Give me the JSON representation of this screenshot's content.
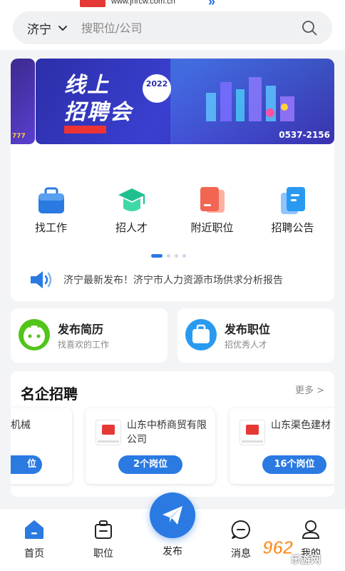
{
  "top_strip": {
    "url": "www.jnrcw.com.cn"
  },
  "search": {
    "city": "济宁",
    "placeholder": "搜职位/公司"
  },
  "banner": {
    "title_line1": "线上",
    "title_line2": "招聘会",
    "year": "2022",
    "phone": "0537-2156"
  },
  "nav": [
    {
      "label": "找工作",
      "icon": "briefcase-icon"
    },
    {
      "label": "招人才",
      "icon": "graduation-cap-icon"
    },
    {
      "label": "附近职位",
      "icon": "document-pages-icon"
    },
    {
      "label": "招聘公告",
      "icon": "announcement-icon"
    }
  ],
  "carousel": {
    "page_count": 4,
    "active_index": 0
  },
  "notice": {
    "text": "济宁最新发布！济宁市人力资源市场供求分析报告"
  },
  "quick": [
    {
      "title": "发布简历",
      "subtitle": "找喜欢的工作"
    },
    {
      "title": "发布职位",
      "subtitle": "招优秀人才"
    }
  ],
  "companies": {
    "title": "名企招聘",
    "more": "更多 >",
    "items": [
      {
        "name": "机械",
        "jobs": "位"
      },
      {
        "name": "山东中桥商贸有限公司",
        "jobs": "2个岗位"
      },
      {
        "name": "山东渠色建材",
        "jobs": "16个岗位"
      }
    ]
  },
  "bottom_nav": {
    "home": "首页",
    "jobs": "职位",
    "publish": "发布",
    "messages": "消息",
    "profile": "我的"
  },
  "watermark": {
    "number": "962",
    "text": "乐游网"
  },
  "colors": {
    "primary": "#2a7ae2",
    "brand_red": "#e53935"
  }
}
